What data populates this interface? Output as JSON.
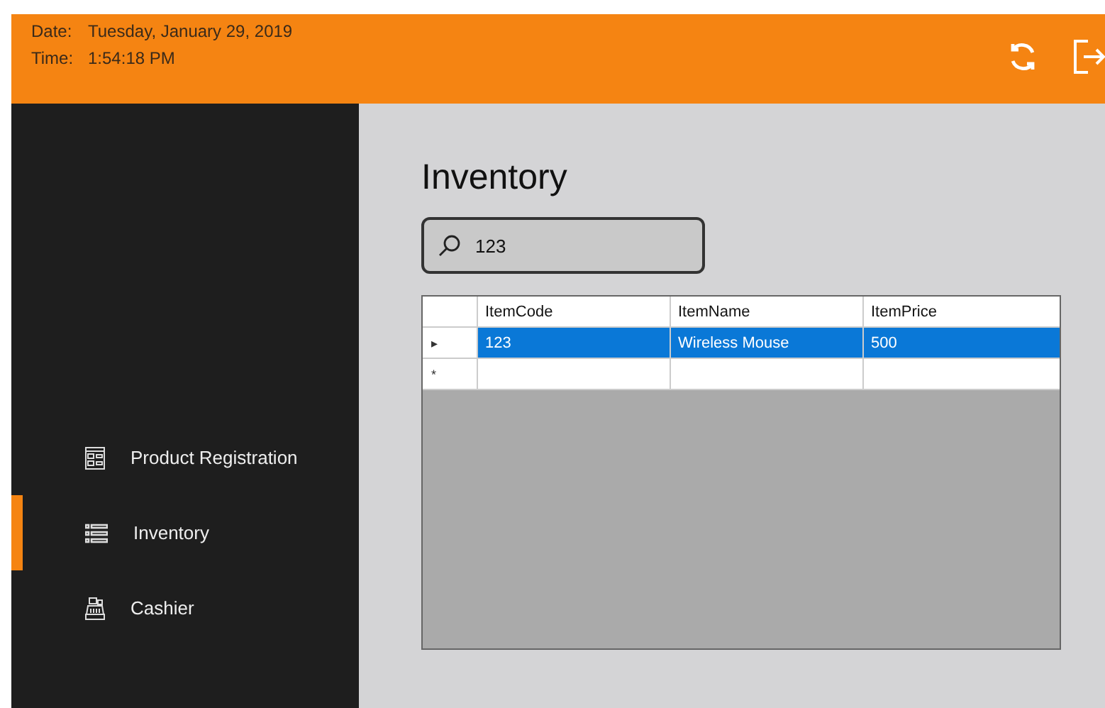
{
  "header": {
    "date_label": "Date:",
    "date": "Tuesday, January 29, 2019",
    "time_label": "Time:",
    "time": "1:54:18 PM"
  },
  "sidebar": {
    "items": [
      {
        "label": "Product Registration",
        "kind": "form",
        "selected": false
      },
      {
        "label": "Inventory",
        "kind": "list",
        "selected": true
      },
      {
        "label": "Cashier",
        "kind": "register",
        "selected": false
      }
    ]
  },
  "page": {
    "title": "Inventory"
  },
  "search": {
    "value": "123"
  },
  "table": {
    "columns": [
      "ItemCode",
      "ItemName",
      "ItemPrice"
    ],
    "rows": [
      {
        "marker": "▸",
        "cells": [
          "123",
          "Wireless Mouse",
          "500"
        ],
        "selected": true
      },
      {
        "marker": "*",
        "cells": [
          "",
          "",
          ""
        ],
        "selected": false
      }
    ]
  }
}
